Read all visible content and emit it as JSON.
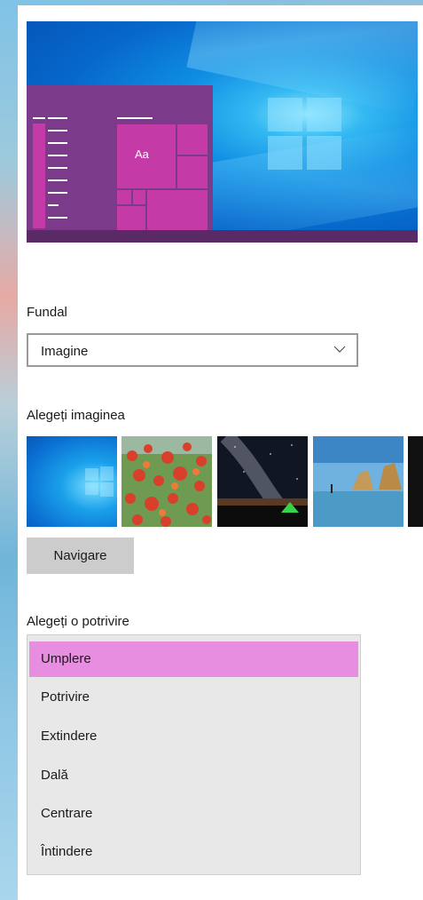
{
  "preview": {
    "thumbnail_text": "Aa"
  },
  "background_section": {
    "label": "Fundal",
    "dropdown_value": "Imagine",
    "dropdown_icon": "chevron-down-icon"
  },
  "picture_section": {
    "label": "Alegeți imaginea",
    "thumbnails": [
      "windows-blue-light",
      "red-poppies",
      "milky-way-tent",
      "beach-rocks-reflection",
      "dark-partial"
    ],
    "browse_label": "Navigare"
  },
  "fit_section": {
    "label": "Alegeți o potrivire",
    "options": [
      "Umplere",
      "Potrivire",
      "Extindere",
      "Dală",
      "Centrare",
      "Întindere"
    ],
    "selected": "Umplere"
  },
  "colors": {
    "accent_purple": "#7b3a8a",
    "tile_magenta": "#c43aa6",
    "selected_option": "#e88ee0",
    "button_gray": "#cccccc"
  }
}
